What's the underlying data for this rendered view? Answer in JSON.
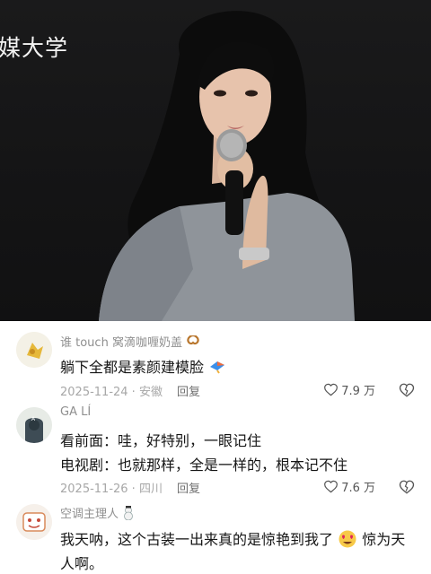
{
  "photo": {
    "overlay_text": "媒大学"
  },
  "comments": [
    {
      "username": "谁 touch 窝滴咖喱奶盖",
      "text_lines": [
        "躺下全都是素颜建模脸"
      ],
      "date_location": "2025-11-24 · 安徽",
      "reply_label": "回复",
      "likes": "7.9 万",
      "icons": [
        "pretzel-emoji",
        "kite-emoji"
      ]
    },
    {
      "username": "GA LÍ",
      "text_lines": [
        "看前面：哇，好特别，一眼记住",
        "电视剧：也就那样，全是一样的，根本记不住"
      ],
      "date_location": "2025-11-26 · 四川",
      "reply_label": "回复",
      "likes": "7.6 万"
    },
    {
      "username": "空调主理人",
      "text_lines": [
        "我天呐，这个古装一出来真的是惊艳到我了",
        "惊为天",
        "人啊。"
      ],
      "icons": [
        "snowman-emoji",
        "heart-eyes-emoji"
      ]
    }
  ],
  "colors": {
    "primary_text": "#161616",
    "secondary_text": "#8f8f8f",
    "meta_text": "#a7a7a7",
    "photo_bg": "#141415"
  }
}
